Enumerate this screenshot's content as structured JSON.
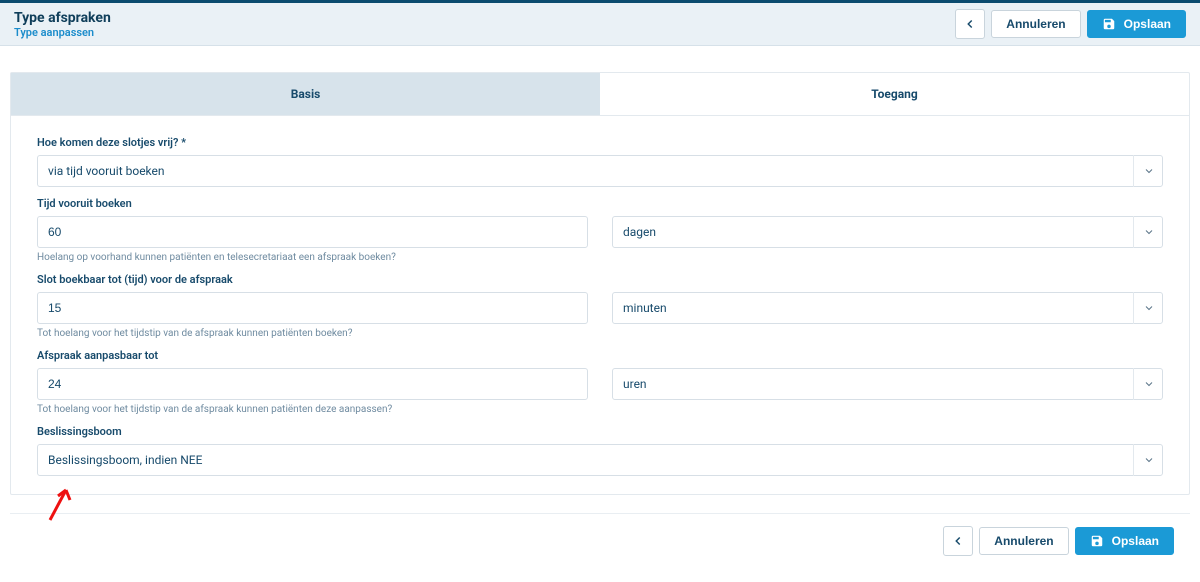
{
  "header": {
    "title": "Type afspraken",
    "subtitle": "Type aanpassen",
    "back_aria": "Terug",
    "cancel": "Annuleren",
    "save": "Opslaan"
  },
  "tabs": {
    "basis": "Basis",
    "toegang": "Toegang"
  },
  "form": {
    "slots_free": {
      "label": "Hoe komen deze slotjes vrij? *",
      "value": "via tijd vooruit boeken"
    },
    "advance_booking": {
      "label": "Tijd vooruit boeken",
      "value": "60",
      "unit": "dagen",
      "hint": "Hoelang op voorhand kunnen patiënten en telesecretariaat een afspraak boeken?"
    },
    "book_until": {
      "label": "Slot boekbaar tot (tijd) voor de afspraak",
      "value": "15",
      "unit": "minuten",
      "hint": "Tot hoelang voor het tijdstip van de afspraak kunnen patiënten boeken?"
    },
    "editable_until": {
      "label": "Afspraak aanpasbaar tot",
      "value": "24",
      "unit": "uren",
      "hint": "Tot hoelang voor het tijdstip van de afspraak kunnen patiënten deze aanpassen?"
    },
    "decision_tree": {
      "label": "Beslissingsboom",
      "value": "Beslissingsboom, indien NEE"
    }
  },
  "footer": {
    "cancel": "Annuleren",
    "save": "Opslaan"
  }
}
